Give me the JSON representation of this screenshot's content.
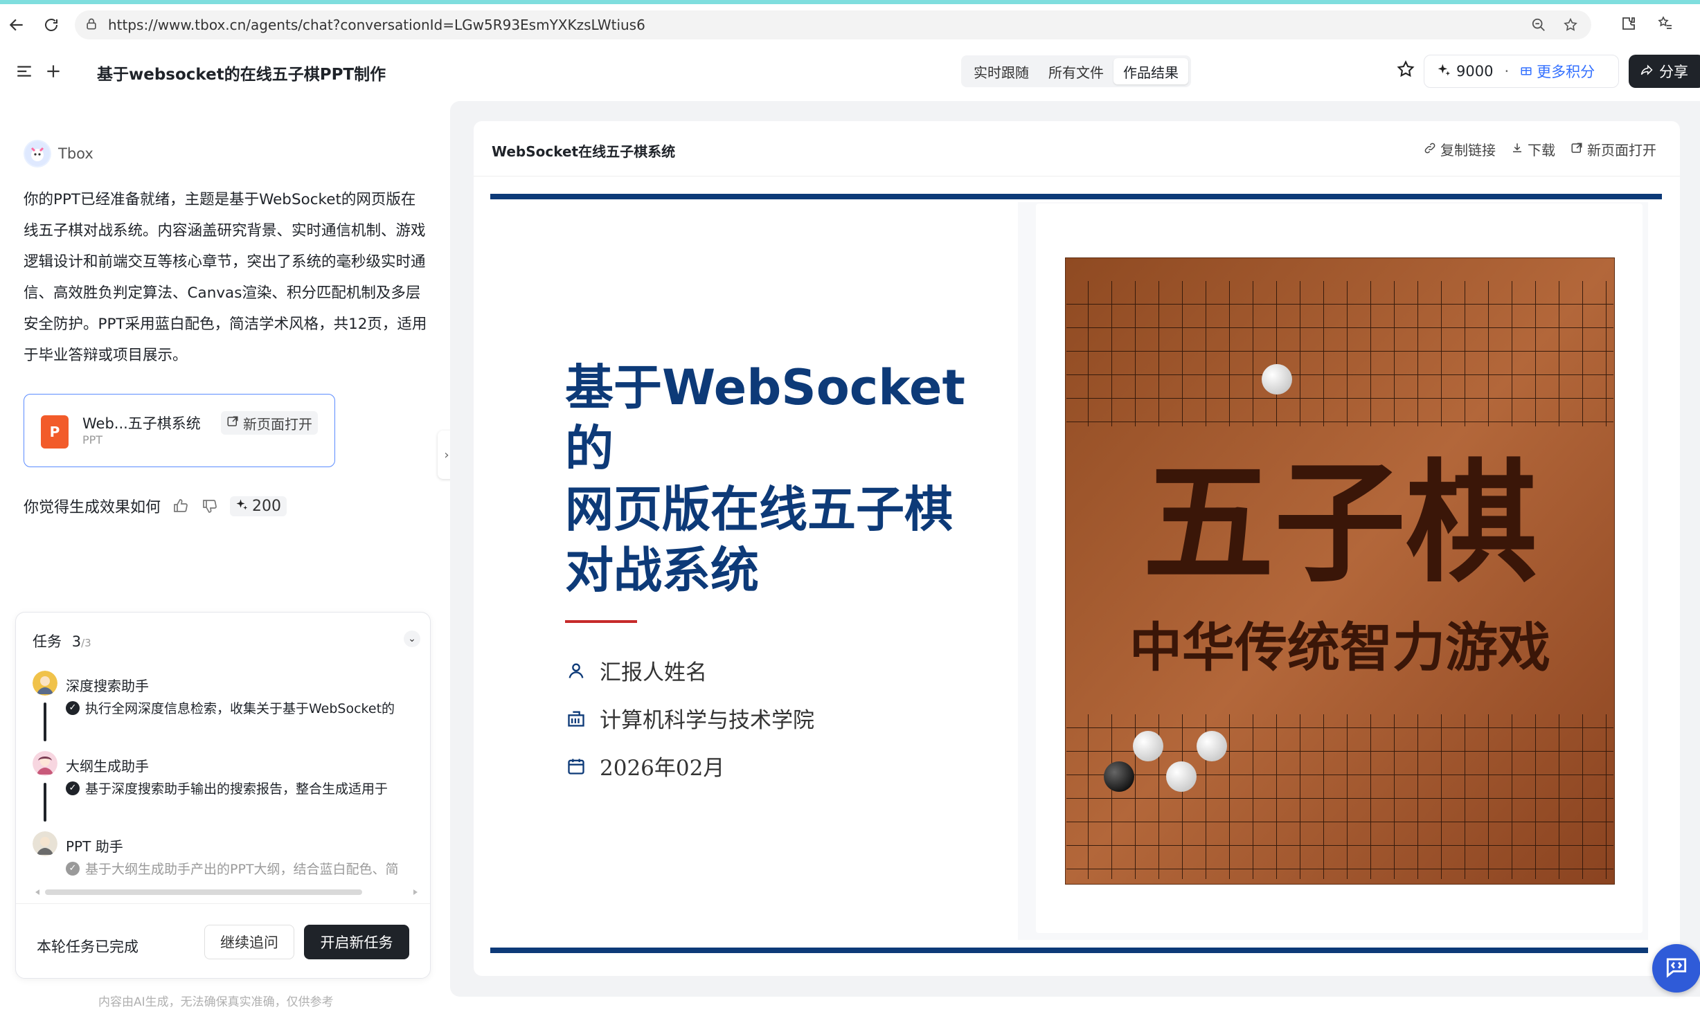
{
  "browser": {
    "url": "https://www.tbox.cn/agents/chat?conversationId=LGw5R93EsmYXKzsLWtius6"
  },
  "header": {
    "title": "基于websocket的在线五子棋PPT制作",
    "tabs": [
      {
        "label": "实时跟随",
        "active": false
      },
      {
        "label": "所有文件",
        "active": false
      },
      {
        "label": "作品结果",
        "active": true
      }
    ],
    "points": "9000",
    "points_separator": "·",
    "more_points": "更多积分",
    "share": "分享"
  },
  "chat": {
    "bot_name": "Tbox",
    "message": "你的PPT已经准备就绪，主题是基于WebSocket的网页版在线五子棋对战系统。内容涵盖研究背景、实时通信机制、游戏逻辑设计和前端交互等核心章节，突出了系统的毫秒级实时通信、高效胜负判定算法、Canvas渲染、积分匹配机制及多层安全防护。PPT采用蓝白配色，简洁学术风格，共12页，适用于毕业答辩或项目展示。",
    "file": {
      "name": "Web...五子棋系统",
      "type": "PPT",
      "icon_letter": "P",
      "open_label": "新页面打开"
    },
    "feedback_prompt": "你觉得生成效果如何",
    "feedback_points": "200"
  },
  "tasks": {
    "title": "任务",
    "done_count": "3",
    "total": "/3",
    "items": [
      {
        "name": "深度搜索助手",
        "desc": "执行全网深度信息检索，收集关于基于WebSocket的"
      },
      {
        "name": "大纲生成助手",
        "desc": "基于深度搜索助手输出的搜索报告，整合生成适用于"
      },
      {
        "name": "PPT 助手",
        "desc": "基于大纲生成助手产出的PPT大纲，结合蓝白配色、简"
      }
    ],
    "status": "本轮任务已完成",
    "follow_up": "继续追问",
    "new_task": "开启新任务"
  },
  "disclaimer": "内容由AI生成，无法确保真实准确，仅供参考",
  "preview": {
    "title": "WebSocket在线五子棋系统",
    "actions": {
      "copy_link": "复制链接",
      "download": "下载",
      "open_new": "新页面打开"
    }
  },
  "slide": {
    "title_lines": [
      "基于WebSocket",
      "的",
      "网页版在线五子棋",
      "对战系统"
    ],
    "reporter": "汇报人姓名",
    "college": "计算机科学与技术学院",
    "date": "2026年02月",
    "image_big_text": "五子棋",
    "image_sub_text": "中华传统智力游戏"
  },
  "colors": {
    "accent_blue": "#0d3a78",
    "red_rule": "#c62a2a",
    "link_blue": "#3370ff",
    "wood": "#a0552b"
  }
}
